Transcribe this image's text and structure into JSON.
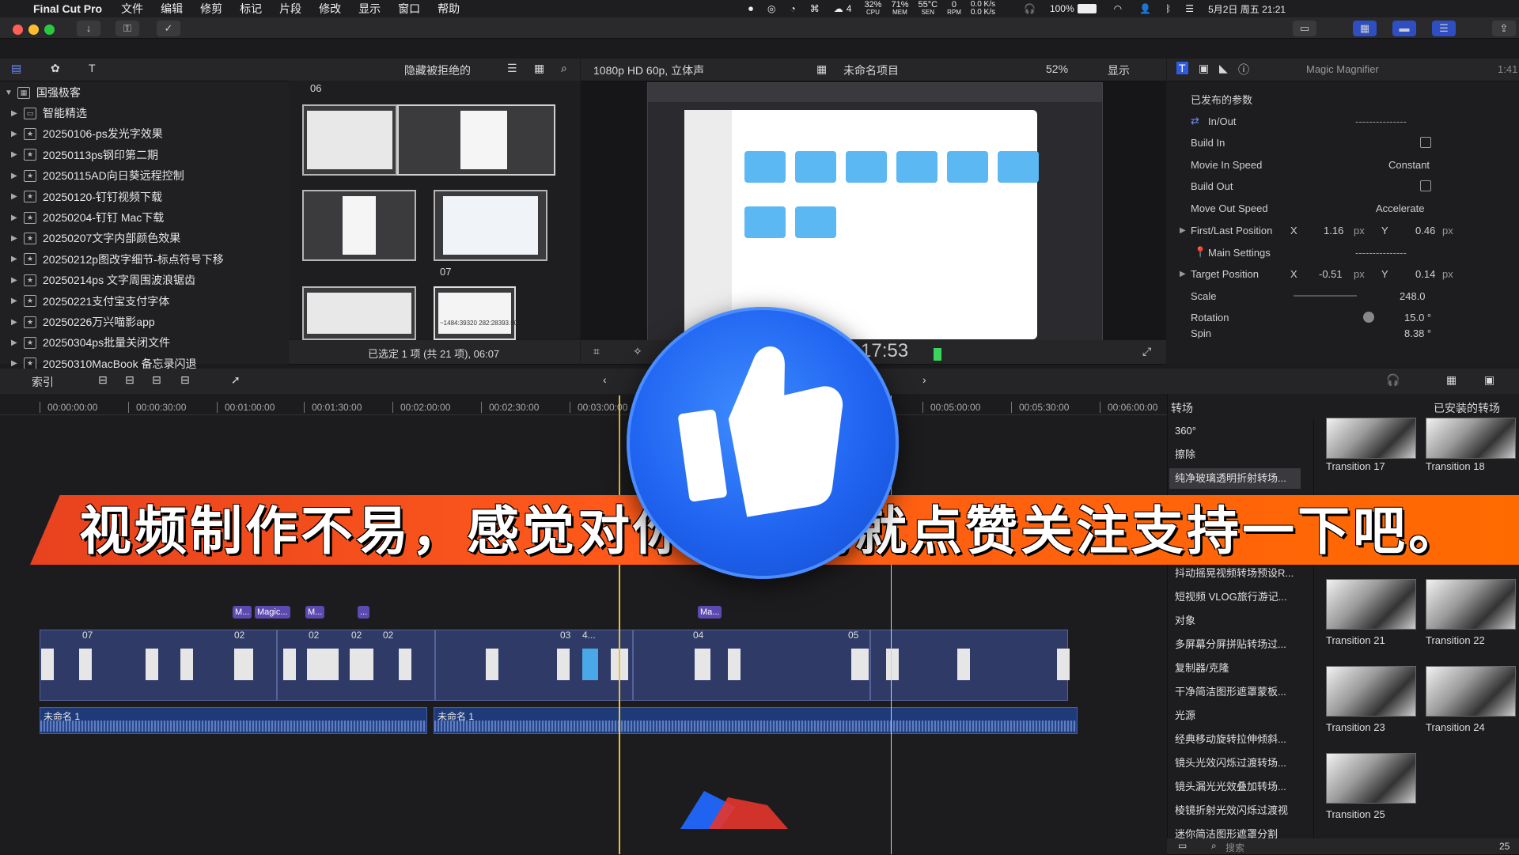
{
  "menubar": {
    "app_name": "Final Cut Pro",
    "menus": [
      "文件",
      "编辑",
      "修剪",
      "标记",
      "片段",
      "修改",
      "显示",
      "窗口",
      "帮助"
    ],
    "status": {
      "count": "4",
      "cpu": "32%",
      "cpu_label": "CPU",
      "mem": "71%",
      "mem_label": "MEM",
      "sen": "55°C",
      "sen_label": "SEN",
      "rpm": "0",
      "rpm_label": "RPM",
      "net_up": "0.0 K/s",
      "net_down": "0.0 K/s",
      "battery": "100%",
      "datetime": "5月2日 周五 21:21"
    }
  },
  "browser": {
    "filter_label": "隐藏被拒绝的",
    "library_name": "国强极客",
    "events": [
      "智能精选",
      "20250106-ps发光字效果",
      "20250113ps钢印第二期",
      "20250115AD向日葵远程控制",
      "20250120-钉钉视频下载",
      "20250204-钉钉 Mac下载",
      "20250207文字内部颜色效果",
      "20250212p图改字细节-标点符号下移",
      "20250214ps 文字周围波浪锯齿",
      "20250221支付宝支付字体",
      "20250226万兴喵影app",
      "20250304ps批量关闭文件",
      "20250310MacBook 备忘录闪退"
    ],
    "group_labels": [
      "06",
      "07"
    ],
    "thumb_caption": "~1484:39320 282:28393.50",
    "selection_status": "已选定 1 项 (共 21 项), 06:07"
  },
  "viewer": {
    "format": "1080p HD 60p, 立体声",
    "project_name": "未命名项目",
    "zoom": "52%",
    "display_label": "显示",
    "timecode": "17:53"
  },
  "inspector": {
    "title": "Magic Magnifier",
    "duration": "1:41",
    "section": "已发布的参数",
    "rows": {
      "in_out": "In/Out",
      "build_in": "Build In",
      "movie_in_speed": "Movie In Speed",
      "movie_in_speed_val": "Constant",
      "build_out": "Build Out",
      "move_out_speed": "Move Out Speed",
      "move_out_speed_val": "Accelerate",
      "first_last": "First/Last Position",
      "first_last_x": "1.16",
      "first_last_y": "0.46",
      "main_settings": "Main Settings",
      "target_position": "Target Position",
      "target_x": "-0.51",
      "target_y": "0.14",
      "scale": "Scale",
      "scale_val": "248.0",
      "rotation": "Rotation",
      "rotation_val": "15.0 °",
      "spin": "Spin",
      "spin_val": "8.38 °",
      "x_label": "X",
      "y_label": "Y",
      "px_unit": "px",
      "dashes": "---------------"
    }
  },
  "timeline": {
    "index_label": "索引",
    "ruler": [
      "00:00:00:00",
      "00:00:30:00",
      "00:01:00:00",
      "00:01:30:00",
      "00:02:00:00",
      "00:02:30:00",
      "00:03:00:00",
      "00:05:00:00",
      "00:05:30:00",
      "00:06:00:00"
    ],
    "tags": [
      "...",
      "M...",
      "Magic...",
      "M...",
      "...",
      "Ma..."
    ],
    "clip_numbers": [
      "07",
      "02",
      "02",
      "02",
      "02",
      "03",
      "4...",
      "04",
      "05"
    ],
    "audio_label_1": "未命名 1",
    "audio_label_2": "未命名 1"
  },
  "transitions": {
    "title": "转场",
    "installed": "已安装的转场",
    "categories": [
      "360°",
      "擦除",
      "纯净玻璃透明折射转场...",
      "抖动摇晃视频转场预设R...",
      "短视频 VLOG旅行游记...",
      "对象",
      "多屏幕分屏拼贴转场过...",
      "复制器/克隆",
      "干净简洁图形遮罩蒙板...",
      "光源",
      "经典移动旋转拉伸倾斜...",
      "镜头光效闪烁过渡转场...",
      "镜头漏光光效叠加转场...",
      "棱镜折射光效闪烁过渡视",
      "迷你简洁图形遮罩分割"
    ],
    "items": [
      "Transition 17",
      "Transition 18",
      "Transition 21",
      "Transition 22",
      "Transition 23",
      "Transition 24",
      "Transition 25"
    ],
    "search_placeholder": "搜索",
    "count": "25"
  },
  "overlay": {
    "banner_text": "视频制作不易，感觉对你有帮助就点赞关注支持一下吧。",
    "colors": {
      "banner": "#ff5a1a",
      "like": "#1f63f0"
    }
  }
}
